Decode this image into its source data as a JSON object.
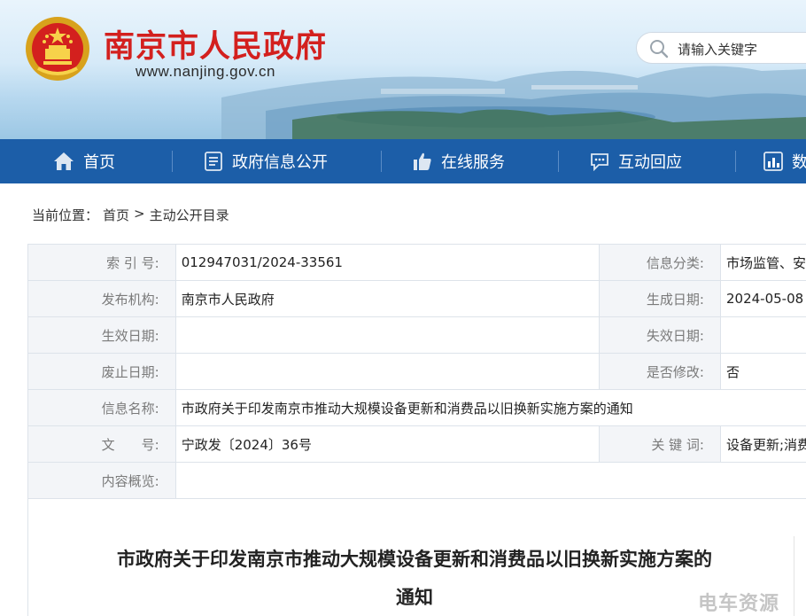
{
  "header": {
    "site_title": "南京市人民政府",
    "site_url": "www.nanjing.gov.cn",
    "search_placeholder": "请输入关键字"
  },
  "nav": {
    "items": [
      {
        "label": "首页",
        "icon": "home-icon"
      },
      {
        "label": "政府信息公开",
        "icon": "document-list-icon"
      },
      {
        "label": "在线服务",
        "icon": "thumbs-up-icon"
      },
      {
        "label": "互动回应",
        "icon": "chat-bubble-icon"
      },
      {
        "label": "数",
        "icon": "chart-icon"
      }
    ]
  },
  "breadcrumb": {
    "prefix": "当前位置：",
    "home": "首页",
    "separator": ">",
    "current": "主动公开目录"
  },
  "info": {
    "index_no_label": "索 引 号:",
    "index_no": "012947031/2024-33561",
    "category_label": "信息分类:",
    "category": "市场监管、安",
    "publisher_label": "发布机构:",
    "publisher": "南京市人民政府",
    "created_label": "生成日期:",
    "created": "2024-05-08",
    "effective_label": "生效日期:",
    "effective": "",
    "expire_label": "失效日期:",
    "expire": "",
    "abolish_label": "废止日期:",
    "abolish": "",
    "modified_label": "是否修改:",
    "modified": "否",
    "name_label": "信息名称:",
    "name": "市政府关于印发南京市推动大规模设备更新和消费品以旧换新实施方案的通知",
    "doc_no_label": "文　　号:",
    "doc_no": "宁政发〔2024〕36号",
    "keywords_label": "关 键 词:",
    "keywords": "设备更新;消费",
    "summary_label": "内容概览:",
    "summary": ""
  },
  "document": {
    "title_line1": "市政府关于印发南京市推动大规模设备更新和消费品以旧换新实施方案的",
    "title_line2": "通知"
  },
  "watermark": "电车资源",
  "colors": {
    "nav_bg": "#1c5ea8",
    "title_red": "#d3201e",
    "label_bg": "#f3f5f8"
  }
}
